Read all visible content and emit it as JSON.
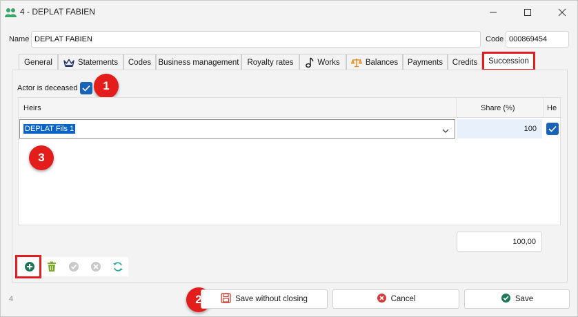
{
  "window": {
    "title": "4 - DEPLAT FABIEN"
  },
  "header": {
    "name_label": "Name",
    "name_value": "DEPLAT FABIEN",
    "code_label": "Code",
    "code_value": "000869454"
  },
  "tabs": [
    {
      "label": "General",
      "icon": ""
    },
    {
      "label": "Statements",
      "icon": "crown-icon"
    },
    {
      "label": "Codes",
      "icon": ""
    },
    {
      "label": "Business management",
      "icon": ""
    },
    {
      "label": "Royalty rates",
      "icon": ""
    },
    {
      "label": "Works",
      "icon": "music-note-icon"
    },
    {
      "label": "Balances",
      "icon": "scales-icon"
    },
    {
      "label": "Payments",
      "icon": ""
    },
    {
      "label": "Credits",
      "icon": ""
    },
    {
      "label": "Succession",
      "icon": "",
      "active": true
    }
  ],
  "succession": {
    "deceased_label": "Actor is deceased",
    "deceased_checked": true
  },
  "grid": {
    "columns": [
      "Heirs",
      "Share (%)",
      "He"
    ],
    "rows": [
      {
        "heir": "DEPLAT Fils 1",
        "share": "100",
        "checked": true
      }
    ],
    "total": "100,00"
  },
  "annotations": [
    "1",
    "2",
    "3"
  ],
  "footer": {
    "record_number": "4",
    "save_without_closing_label": "Save without closing",
    "cancel_label": "Cancel",
    "save_label": "Save"
  },
  "colors": {
    "highlight_red": "#e02020",
    "badge_red": "#e31c1c",
    "checkbox_blue": "#1a64b8",
    "selection_blue": "#0a64c8",
    "add_green": "#1b7a55"
  }
}
